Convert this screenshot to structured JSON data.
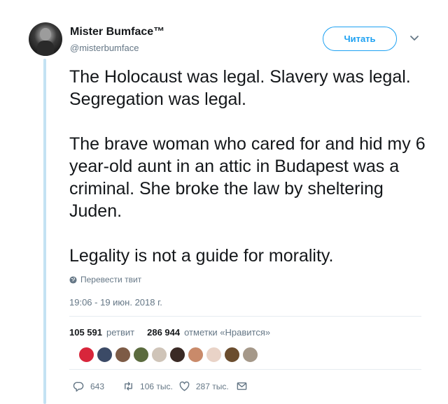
{
  "author": {
    "name": "Mister Bumface™",
    "handle": "@misterbumface"
  },
  "follow_label": "Читать",
  "tweet": {
    "paragraphs": [
      "The Holocaust was legal. Slavery was legal. Segregation was legal.",
      "The brave woman who cared for and hid my 6 year-old aunt in an attic in Budapest was a criminal. She broke the law by sheltering Juden.",
      "Legality is not a guide for morality."
    ]
  },
  "translate_label": "Перевести твит",
  "timestamp": "19:06 - 19 июн. 2018 г.",
  "stats": {
    "retweets_count": "105 591",
    "retweets_label": "ретвит",
    "likes_count": "286 944",
    "likes_label": "отметки «Нравится»"
  },
  "liker_colors": [
    "#d8263b",
    "#3b4a66",
    "#7d5b46",
    "#5b6b3e",
    "#cfc4b8",
    "#3a2a25",
    "#c98a6a",
    "#e9d3c7",
    "#6b4d2e",
    "#a59889"
  ],
  "actions": {
    "reply_count": "643",
    "retweet_count": "106 тыс.",
    "like_count": "287 тыс."
  },
  "colors": {
    "accent": "#1da1f2",
    "thread_line": "#c4e2f3",
    "muted": "#657786"
  },
  "icons": [
    "globe-icon",
    "chevron-down-icon",
    "reply-icon",
    "retweet-icon",
    "heart-icon",
    "envelope-icon"
  ]
}
